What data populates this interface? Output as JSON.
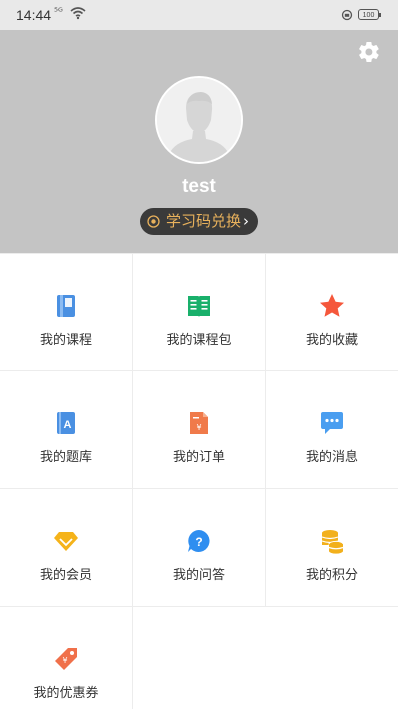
{
  "status_bar": {
    "time": "14:44",
    "signal_text": "⁵ᴳ",
    "battery": "100"
  },
  "profile": {
    "username": "test",
    "redeem_label": "学习码兑换",
    "redeem_arrow": "›"
  },
  "menu": {
    "items": [
      {
        "label": "我的课程",
        "icon": "course-book-icon",
        "color": "#4a90e2"
      },
      {
        "label": "我的课程包",
        "icon": "course-package-icon",
        "color": "#19b06b"
      },
      {
        "label": "我的收藏",
        "icon": "star-icon",
        "color": "#f5573b"
      },
      {
        "label": "我的题库",
        "icon": "question-bank-icon",
        "color": "#4a90e2"
      },
      {
        "label": "我的订单",
        "icon": "order-icon",
        "color": "#f07a4a"
      },
      {
        "label": "我的消息",
        "icon": "message-icon",
        "color": "#4a9ef0"
      },
      {
        "label": "我的会员",
        "icon": "vip-gem-icon",
        "color": "#f5b31a"
      },
      {
        "label": "我的问答",
        "icon": "qa-icon",
        "color": "#2f8ef0"
      },
      {
        "label": "我的积分",
        "icon": "coins-icon",
        "color": "#f2b01c"
      },
      {
        "label": "我的优惠券",
        "icon": "coupon-icon",
        "color": "#f0704a"
      }
    ]
  }
}
